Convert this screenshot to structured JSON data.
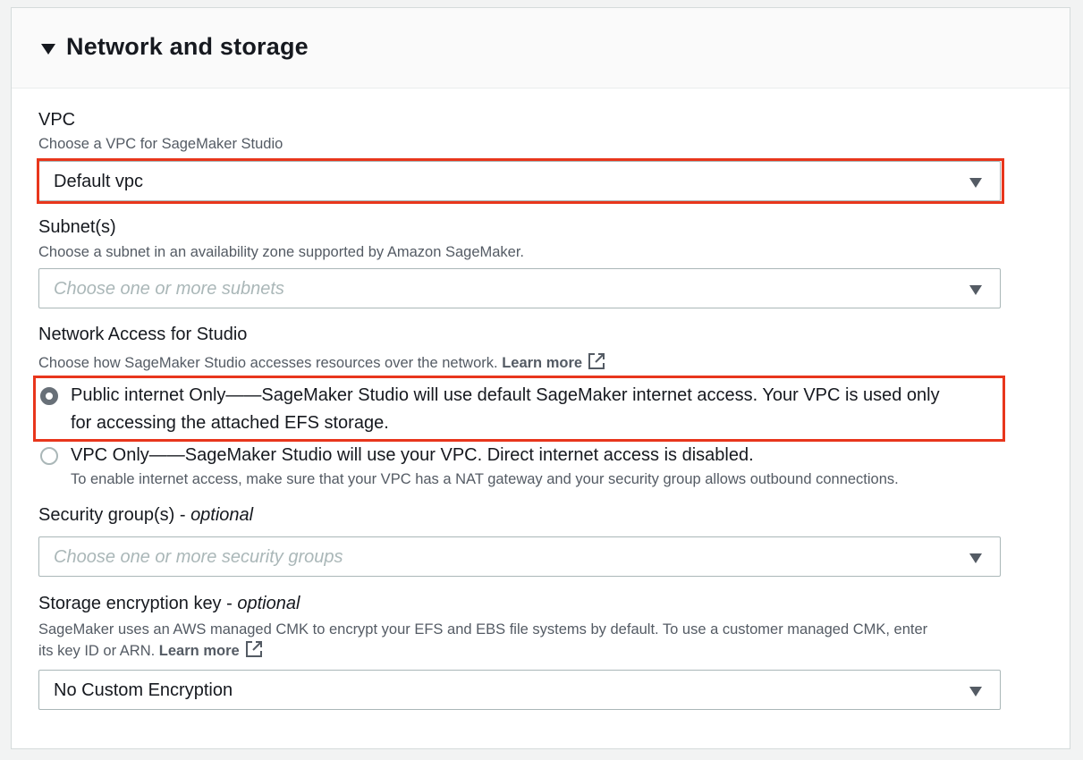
{
  "section": {
    "title": "Network and storage",
    "expanded": true
  },
  "vpc": {
    "label": "VPC",
    "description": "Choose a VPC for SageMaker Studio",
    "value": "Default vpc"
  },
  "subnets": {
    "label": "Subnet(s)",
    "description": "Choose a subnet in an availability zone supported by Amazon SageMaker.",
    "placeholder": "Choose one or more subnets"
  },
  "network_access": {
    "label": "Network Access for Studio",
    "description": "Choose how SageMaker Studio accesses resources over the network.",
    "learn_more": "Learn more",
    "options": [
      {
        "line1": "Public internet Only——SageMaker Studio will use default SageMaker internet access. Your VPC is used only",
        "line2": "for accessing the attached EFS storage.",
        "selected": true
      },
      {
        "line1": "VPC Only——SageMaker Studio will use your VPC. Direct internet access is disabled.",
        "sub": "To enable internet access, make sure that your VPC has a NAT gateway and your security group allows outbound connections.",
        "selected": false
      }
    ]
  },
  "security_groups": {
    "label": "Security group(s) - ",
    "optional": "optional",
    "placeholder": "Choose one or more security groups"
  },
  "encryption": {
    "label": "Storage encryption key - ",
    "optional": "optional",
    "description_line1": "SageMaker uses an AWS managed CMK to encrypt your EFS and EBS file systems by default. To use a customer managed CMK, enter",
    "description_line2": "its key ID or ARN.",
    "learn_more": "Learn more",
    "value": "No Custom Encryption"
  },
  "colors": {
    "highlight": "#e8361c",
    "text": "#16191f",
    "secondary_text": "#545b64",
    "placeholder": "#aab7b8"
  }
}
